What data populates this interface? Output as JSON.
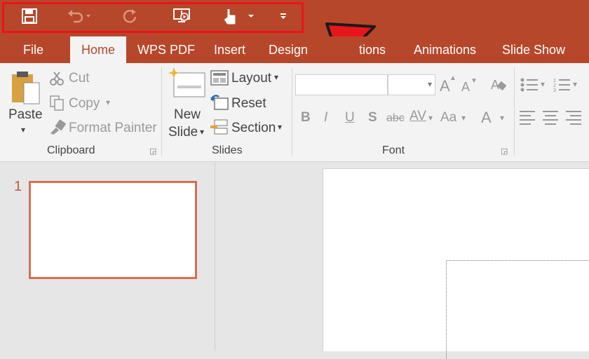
{
  "quick_access": {
    "save_icon": "save-icon",
    "undo_icon": "undo-icon",
    "redo_icon": "redo-icon",
    "present_icon": "start-from-beginning-icon",
    "touch_icon": "touch-mouse-mode-icon",
    "customize_icon": "customize-qat-icon"
  },
  "tabs": [
    "File",
    "Home",
    "WPS PDF",
    "Insert",
    "Design",
    "Transitions",
    "Animations",
    "Slide Show"
  ],
  "visible_tab_fragment": "tions",
  "ribbon": {
    "clipboard": {
      "paste": "Paste",
      "cut": "Cut",
      "copy": "Copy",
      "format_painter": "Format Painter",
      "group_label": "Clipboard"
    },
    "slides": {
      "new_slide_line1": "New",
      "new_slide_line2": "Slide",
      "layout": "Layout",
      "reset": "Reset",
      "section": "Section",
      "group_label": "Slides"
    },
    "font": {
      "group_label": "Font",
      "bold": "B",
      "italic": "I",
      "underline": "U",
      "shadow": "S",
      "strike": "abc",
      "spacing": "AV",
      "case": "Aa",
      "color": "A",
      "grow": "A",
      "shrink": "A"
    }
  },
  "thumbnail_pane": {
    "slide_number": "1"
  },
  "colors": {
    "brand": "#b7472a",
    "highlight": "#e8151d",
    "thumb_border": "#d86f50"
  }
}
